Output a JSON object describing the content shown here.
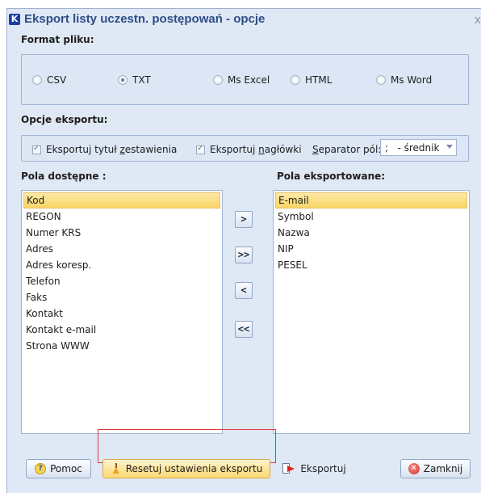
{
  "window": {
    "title": "Eksport listy uczestn. postępowań - opcje",
    "close_glyph": "x",
    "app_icon_letter": "K"
  },
  "format": {
    "label": "Format pliku:",
    "options": [
      {
        "label": "CSV",
        "checked": false
      },
      {
        "label": "TXT",
        "checked": true
      },
      {
        "label": "Ms Excel",
        "checked": false
      },
      {
        "label": "HTML",
        "checked": false
      },
      {
        "label": "Ms Word",
        "checked": false
      }
    ]
  },
  "export_options": {
    "label": "Opcje eksportu:",
    "title_check": {
      "label_pre": "Eksportuj tytuł ",
      "label_acc": "z",
      "label_post": "estawienia",
      "checked": true
    },
    "headers_check": {
      "label_pre": "Eksportuj ",
      "label_acc": "n",
      "label_post": "agłówki",
      "checked": true
    },
    "separator_label_acc": "S",
    "separator_label_rest": "eparator pól:",
    "separator_value": ";   - średnik"
  },
  "available": {
    "label": "Pola dostępne :",
    "selected_index": 0,
    "items": [
      "Kod",
      "REGON",
      "Numer KRS",
      "Adres",
      "Adres koresp.",
      "Telefon",
      "Faks",
      "Kontakt",
      "Kontakt e-mail",
      "Strona WWW"
    ]
  },
  "exported": {
    "label": "Pola eksportowane:",
    "selected_index": 0,
    "items": [
      "E-mail",
      "Symbol",
      "Nazwa",
      "NIP",
      "PESEL"
    ]
  },
  "move_buttons": {
    "add": ">",
    "add_all": ">>",
    "remove": "<",
    "remove_all": "<<"
  },
  "buttons": {
    "help": "Pomoc",
    "reset": "Resetuj ustawienia eksportu",
    "export": "Eksportuj",
    "close": "Zamknij"
  },
  "icons": {
    "help": "help-icon",
    "reset": "broom-icon",
    "export": "export-icon",
    "close": "close-icon"
  }
}
